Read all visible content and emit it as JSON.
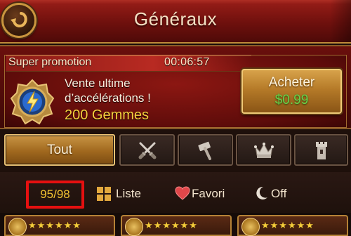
{
  "header": {
    "title": "Généraux"
  },
  "promotion": {
    "label": "Super promotion",
    "timer": "00:06:57",
    "description_line1": "Vente ultime",
    "description_line2": "d’accélérations !",
    "gems": "200 Gemmes",
    "buy_label": "Acheter",
    "buy_price": "$0.99"
  },
  "tabs": [
    {
      "label": "Tout",
      "active": true
    },
    {
      "icon": "crossed-swords-icon"
    },
    {
      "icon": "hammer-icon"
    },
    {
      "icon": "crown-icon"
    },
    {
      "icon": "tower-icon"
    }
  ],
  "status": {
    "count": "95/98",
    "list_label": "Liste",
    "fav_label": "Favori",
    "off_label": "Off"
  },
  "cards": [
    {
      "stars": "★★★★★★"
    },
    {
      "stars": "★★★★★★"
    },
    {
      "stars": "★★★★★★"
    }
  ],
  "colors": {
    "header_red": "#7a130f",
    "gold": "#c9953e",
    "price_green": "#66d24a",
    "gems_yellow": "#f6cf3e",
    "highlight_red": "#e51010"
  }
}
